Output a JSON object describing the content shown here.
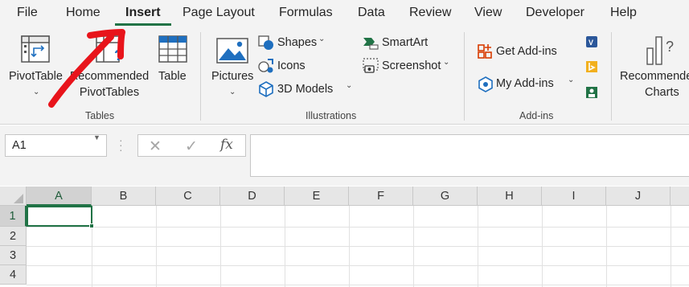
{
  "tabs": [
    {
      "label": "File"
    },
    {
      "label": "Home"
    },
    {
      "label": "Insert"
    },
    {
      "label": "Page Layout"
    },
    {
      "label": "Formulas"
    },
    {
      "label": "Data"
    },
    {
      "label": "Review"
    },
    {
      "label": "View"
    },
    {
      "label": "Developer"
    },
    {
      "label": "Help"
    }
  ],
  "active_tab": "Insert",
  "ribbon": {
    "tables": {
      "group_label": "Tables",
      "pivottable_label": "PivotTable",
      "recommended_pivottables_line1": "Recommended",
      "recommended_pivottables_line2": "PivotTables",
      "table_label": "Table"
    },
    "illustrations": {
      "group_label": "Illustrations",
      "pictures_label": "Pictures",
      "shapes_label": "Shapes",
      "icons_label": "Icons",
      "models3d_label": "3D Models",
      "smartart_label": "SmartArt",
      "screenshot_label": "Screenshot"
    },
    "addins": {
      "group_label": "Add-ins",
      "get_addins_label": "Get Add-ins",
      "my_addins_label": "My Add-ins"
    },
    "charts": {
      "recommended_charts_line1": "Recommended",
      "recommended_charts_line2": "Charts"
    }
  },
  "formula_bar": {
    "name_box_value": "A1",
    "fx_label": "fx",
    "formula_value": ""
  },
  "grid": {
    "columns": [
      "A",
      "B",
      "C",
      "D",
      "E",
      "F",
      "G",
      "H",
      "I",
      "J"
    ],
    "rows": [
      "1",
      "2",
      "3",
      "4"
    ],
    "selected_cell": "A1"
  },
  "colors": {
    "accent_green": "#217346",
    "annotation_red": "#e8141b"
  }
}
